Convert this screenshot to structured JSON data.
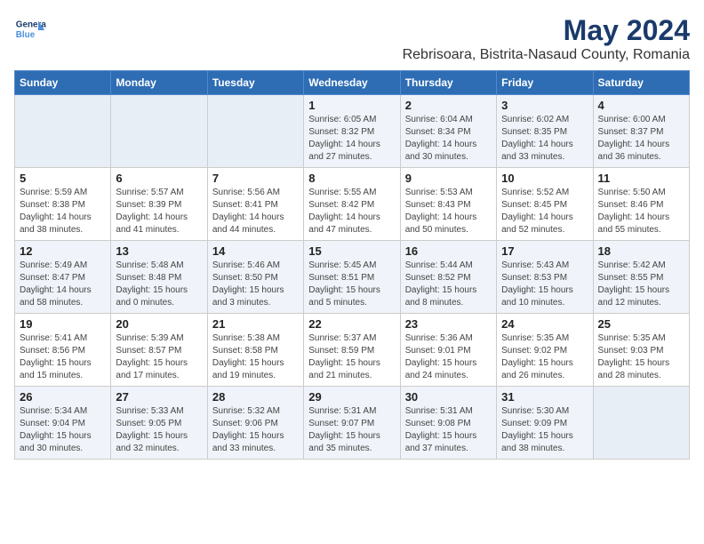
{
  "logo": {
    "line1": "General",
    "line2": "Blue"
  },
  "title": "May 2024",
  "subtitle": "Rebrisoara, Bistrita-Nasaud County, Romania",
  "days_of_week": [
    "Sunday",
    "Monday",
    "Tuesday",
    "Wednesday",
    "Thursday",
    "Friday",
    "Saturday"
  ],
  "weeks": [
    [
      {
        "day": "",
        "info": ""
      },
      {
        "day": "",
        "info": ""
      },
      {
        "day": "",
        "info": ""
      },
      {
        "day": "1",
        "info": "Sunrise: 6:05 AM\nSunset: 8:32 PM\nDaylight: 14 hours\nand 27 minutes."
      },
      {
        "day": "2",
        "info": "Sunrise: 6:04 AM\nSunset: 8:34 PM\nDaylight: 14 hours\nand 30 minutes."
      },
      {
        "day": "3",
        "info": "Sunrise: 6:02 AM\nSunset: 8:35 PM\nDaylight: 14 hours\nand 33 minutes."
      },
      {
        "day": "4",
        "info": "Sunrise: 6:00 AM\nSunset: 8:37 PM\nDaylight: 14 hours\nand 36 minutes."
      }
    ],
    [
      {
        "day": "5",
        "info": "Sunrise: 5:59 AM\nSunset: 8:38 PM\nDaylight: 14 hours\nand 38 minutes."
      },
      {
        "day": "6",
        "info": "Sunrise: 5:57 AM\nSunset: 8:39 PM\nDaylight: 14 hours\nand 41 minutes."
      },
      {
        "day": "7",
        "info": "Sunrise: 5:56 AM\nSunset: 8:41 PM\nDaylight: 14 hours\nand 44 minutes."
      },
      {
        "day": "8",
        "info": "Sunrise: 5:55 AM\nSunset: 8:42 PM\nDaylight: 14 hours\nand 47 minutes."
      },
      {
        "day": "9",
        "info": "Sunrise: 5:53 AM\nSunset: 8:43 PM\nDaylight: 14 hours\nand 50 minutes."
      },
      {
        "day": "10",
        "info": "Sunrise: 5:52 AM\nSunset: 8:45 PM\nDaylight: 14 hours\nand 52 minutes."
      },
      {
        "day": "11",
        "info": "Sunrise: 5:50 AM\nSunset: 8:46 PM\nDaylight: 14 hours\nand 55 minutes."
      }
    ],
    [
      {
        "day": "12",
        "info": "Sunrise: 5:49 AM\nSunset: 8:47 PM\nDaylight: 14 hours\nand 58 minutes."
      },
      {
        "day": "13",
        "info": "Sunrise: 5:48 AM\nSunset: 8:48 PM\nDaylight: 15 hours\nand 0 minutes."
      },
      {
        "day": "14",
        "info": "Sunrise: 5:46 AM\nSunset: 8:50 PM\nDaylight: 15 hours\nand 3 minutes."
      },
      {
        "day": "15",
        "info": "Sunrise: 5:45 AM\nSunset: 8:51 PM\nDaylight: 15 hours\nand 5 minutes."
      },
      {
        "day": "16",
        "info": "Sunrise: 5:44 AM\nSunset: 8:52 PM\nDaylight: 15 hours\nand 8 minutes."
      },
      {
        "day": "17",
        "info": "Sunrise: 5:43 AM\nSunset: 8:53 PM\nDaylight: 15 hours\nand 10 minutes."
      },
      {
        "day": "18",
        "info": "Sunrise: 5:42 AM\nSunset: 8:55 PM\nDaylight: 15 hours\nand 12 minutes."
      }
    ],
    [
      {
        "day": "19",
        "info": "Sunrise: 5:41 AM\nSunset: 8:56 PM\nDaylight: 15 hours\nand 15 minutes."
      },
      {
        "day": "20",
        "info": "Sunrise: 5:39 AM\nSunset: 8:57 PM\nDaylight: 15 hours\nand 17 minutes."
      },
      {
        "day": "21",
        "info": "Sunrise: 5:38 AM\nSunset: 8:58 PM\nDaylight: 15 hours\nand 19 minutes."
      },
      {
        "day": "22",
        "info": "Sunrise: 5:37 AM\nSunset: 8:59 PM\nDaylight: 15 hours\nand 21 minutes."
      },
      {
        "day": "23",
        "info": "Sunrise: 5:36 AM\nSunset: 9:01 PM\nDaylight: 15 hours\nand 24 minutes."
      },
      {
        "day": "24",
        "info": "Sunrise: 5:35 AM\nSunset: 9:02 PM\nDaylight: 15 hours\nand 26 minutes."
      },
      {
        "day": "25",
        "info": "Sunrise: 5:35 AM\nSunset: 9:03 PM\nDaylight: 15 hours\nand 28 minutes."
      }
    ],
    [
      {
        "day": "26",
        "info": "Sunrise: 5:34 AM\nSunset: 9:04 PM\nDaylight: 15 hours\nand 30 minutes."
      },
      {
        "day": "27",
        "info": "Sunrise: 5:33 AM\nSunset: 9:05 PM\nDaylight: 15 hours\nand 32 minutes."
      },
      {
        "day": "28",
        "info": "Sunrise: 5:32 AM\nSunset: 9:06 PM\nDaylight: 15 hours\nand 33 minutes."
      },
      {
        "day": "29",
        "info": "Sunrise: 5:31 AM\nSunset: 9:07 PM\nDaylight: 15 hours\nand 35 minutes."
      },
      {
        "day": "30",
        "info": "Sunrise: 5:31 AM\nSunset: 9:08 PM\nDaylight: 15 hours\nand 37 minutes."
      },
      {
        "day": "31",
        "info": "Sunrise: 5:30 AM\nSunset: 9:09 PM\nDaylight: 15 hours\nand 38 minutes."
      },
      {
        "day": "",
        "info": ""
      }
    ]
  ]
}
